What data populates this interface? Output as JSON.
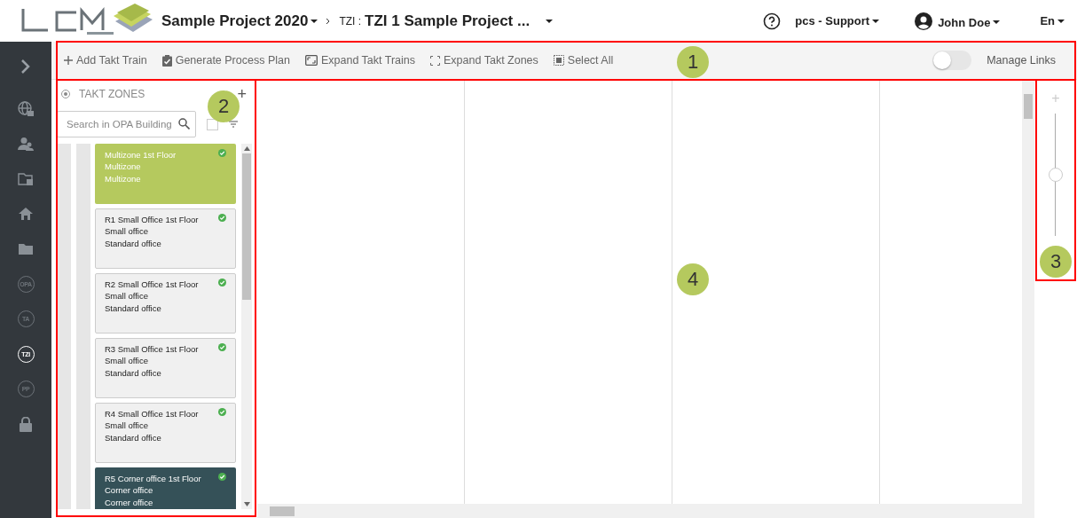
{
  "header": {
    "project": "Sample Project 2020",
    "breadcrumb_prefix": "TZI :",
    "breadcrumb_title": "TZI 1 Sample Project ...",
    "support": "pcs - Support",
    "user": "John Doe",
    "language": "En"
  },
  "sidebar": {
    "items": [
      {
        "kind": "chevron",
        "selected": false
      },
      {
        "kind": "globe",
        "selected": false
      },
      {
        "kind": "user",
        "selected": false
      },
      {
        "kind": "folder-doc",
        "selected": false
      },
      {
        "kind": "home",
        "selected": false
      },
      {
        "kind": "folder",
        "selected": false
      },
      {
        "kind": "badge",
        "label": "OPA",
        "selected": false
      },
      {
        "kind": "badge",
        "label": "TA",
        "selected": false
      },
      {
        "kind": "badge",
        "label": "TZI",
        "selected": true
      },
      {
        "kind": "badge",
        "label": "PP",
        "selected": false
      },
      {
        "kind": "lock",
        "selected": false
      }
    ]
  },
  "toolbar": {
    "actions": [
      {
        "kind": "plus",
        "label": "Add Takt Train"
      },
      {
        "kind": "clipboard",
        "label": "Generate Process Plan"
      },
      {
        "kind": "expand-box",
        "label": "Expand Takt Trains"
      },
      {
        "kind": "corners",
        "label": "Expand Takt Zones"
      },
      {
        "kind": "select",
        "label": "Select All"
      }
    ],
    "manage_links": {
      "label": "Manage Links",
      "on": false
    }
  },
  "zones_panel": {
    "title": "TAKT ZONES",
    "add": "+",
    "search": {
      "placeholder": "Search in OPA Building"
    },
    "select_all_checked": false,
    "cards": [
      {
        "title": "Multizone 1st Floor",
        "line_2": "Multizone",
        "line_3": "Multizone",
        "color": "#b5c95e"
      },
      {
        "title": "R1 Small Office 1st Floor",
        "line_2": "Small office",
        "line_3": "Standard office",
        "color": "#f0f0f0"
      },
      {
        "title": "R2 Small Office 1st Floor",
        "line_2": "Small office",
        "line_3": "Standard office",
        "color": "#f0f0f0"
      },
      {
        "title": "R3 Small Office 1st Floor",
        "line_2": "Small office",
        "line_3": "Standard office",
        "color": "#f0f0f0"
      },
      {
        "title": "R4 Small Office 1st Floor",
        "line_2": "Small office",
        "line_3": "Standard office",
        "color": "#f0f0f0"
      },
      {
        "title": "R5 Corner office 1st Floor",
        "line_2": "Corner office",
        "line_3": "Corner office",
        "color": "#355158"
      }
    ]
  },
  "zoom": {
    "plus": "+",
    "level": 0.5
  },
  "callouts": [
    "1",
    "2",
    "3",
    "4"
  ]
}
